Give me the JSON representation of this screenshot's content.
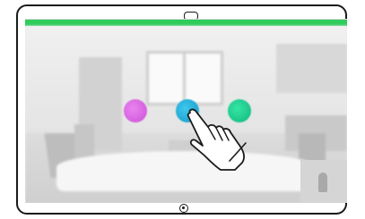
{
  "device": {
    "camera_icon": "camera-icon",
    "home_button_icon": "home-button-icon"
  },
  "screen": {
    "status_bar_color": "#2ecc5a",
    "call_buttons": [
      {
        "icon": "call-button-purple",
        "color": "#d65be0"
      },
      {
        "icon": "call-button-blue",
        "color": "#1aa6d6"
      },
      {
        "icon": "call-button-green",
        "color": "#17c98a"
      }
    ],
    "background": "blurred-meeting-room",
    "self_view": "self-view-thumbnail"
  },
  "gesture": {
    "icon": "tap-hand-icon",
    "target": "call-button-blue"
  }
}
